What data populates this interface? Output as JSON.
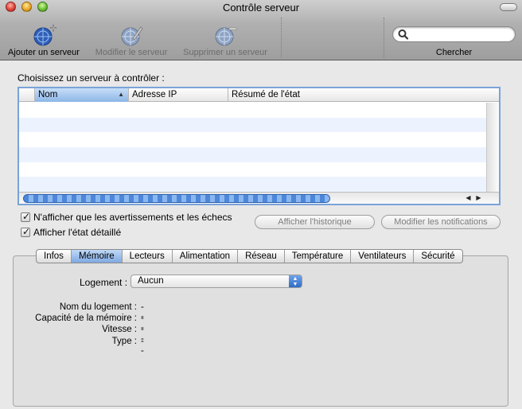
{
  "window": {
    "title": "Contrôle serveur"
  },
  "toolbar": {
    "add_label": "Ajouter un serveur",
    "edit_label": "Modifier le serveur",
    "delete_label": "Supprimer un serveur",
    "search_label": "Chercher",
    "search_value": ""
  },
  "content": {
    "choose_label": "Choisissez un serveur à contrôler :",
    "columns": [
      "Nom",
      "Adresse IP",
      "Résumé de l'état"
    ],
    "sorted_column": "Nom",
    "rows": []
  },
  "options": {
    "warnings_only": "N'afficher que les avertissements et les échecs",
    "detailed_state": "Afficher l'état détaillé",
    "warnings_only_checked": true,
    "detailed_state_checked": true
  },
  "buttons": {
    "history": "Afficher l'historique",
    "notifications": "Modifier les notifications"
  },
  "tabs": [
    "Infos",
    "Mémoire",
    "Lecteurs",
    "Alimentation",
    "Réseau",
    "Température",
    "Ventilateurs",
    "Sécurité"
  ],
  "active_tab": "Mémoire",
  "memory": {
    "slot_label": "Logement :",
    "slot_value": "Aucun",
    "fields": [
      {
        "label": "Nom du logement :",
        "value": "--"
      },
      {
        "label": "Capacité de la mémoire :",
        "value": "--"
      },
      {
        "label": "Vitesse :",
        "value": "--"
      },
      {
        "label": "Type :",
        "value": "--"
      }
    ]
  },
  "colors": {
    "accent": "#7aa3d8",
    "selected_tab": "#8db6e7"
  }
}
